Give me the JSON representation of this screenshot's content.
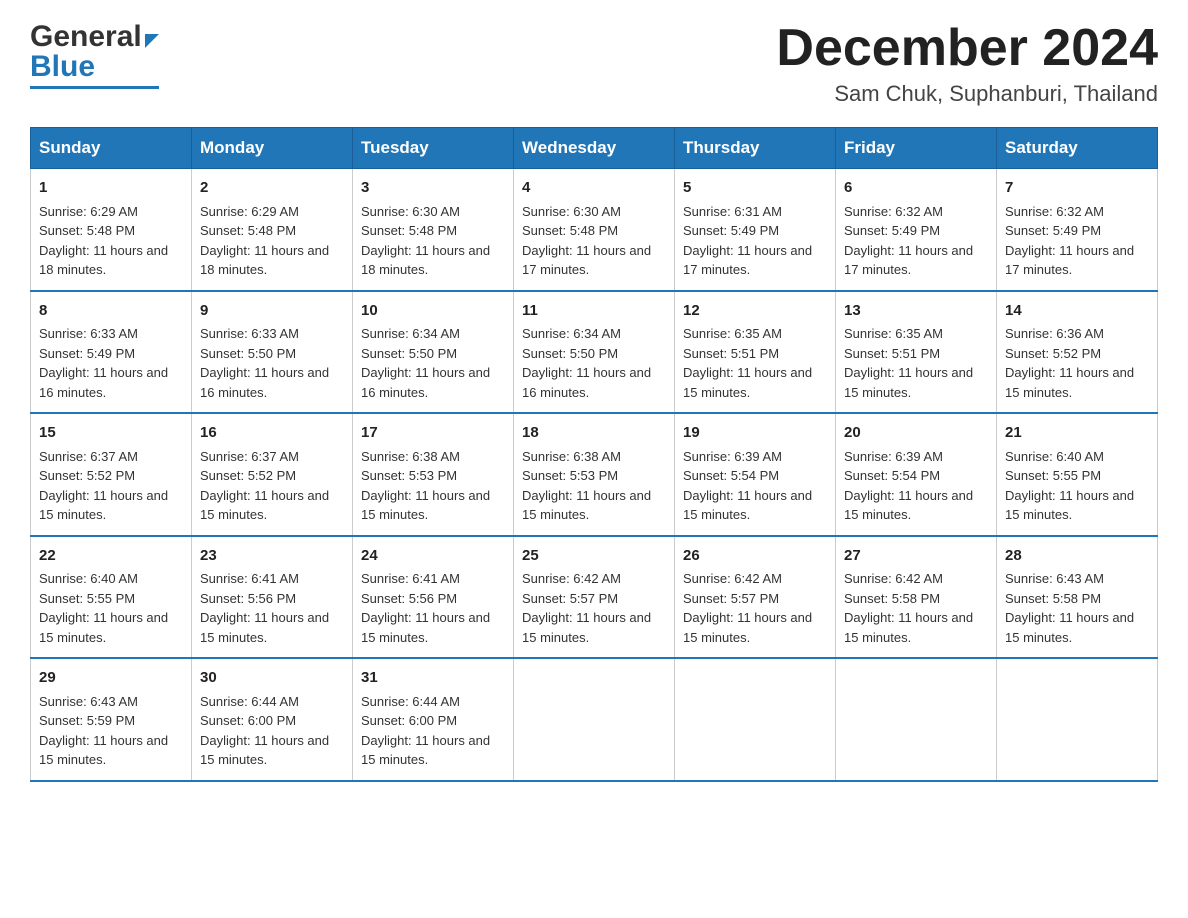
{
  "header": {
    "title": "December 2024",
    "subtitle": "Sam Chuk, Suphanburi, Thailand",
    "logo_general": "General",
    "logo_blue": "Blue"
  },
  "weekdays": [
    "Sunday",
    "Monday",
    "Tuesday",
    "Wednesday",
    "Thursday",
    "Friday",
    "Saturday"
  ],
  "weeks": [
    [
      {
        "day": "1",
        "sunrise": "6:29 AM",
        "sunset": "5:48 PM",
        "daylight": "11 hours and 18 minutes."
      },
      {
        "day": "2",
        "sunrise": "6:29 AM",
        "sunset": "5:48 PM",
        "daylight": "11 hours and 18 minutes."
      },
      {
        "day": "3",
        "sunrise": "6:30 AM",
        "sunset": "5:48 PM",
        "daylight": "11 hours and 18 minutes."
      },
      {
        "day": "4",
        "sunrise": "6:30 AM",
        "sunset": "5:48 PM",
        "daylight": "11 hours and 17 minutes."
      },
      {
        "day": "5",
        "sunrise": "6:31 AM",
        "sunset": "5:49 PM",
        "daylight": "11 hours and 17 minutes."
      },
      {
        "day": "6",
        "sunrise": "6:32 AM",
        "sunset": "5:49 PM",
        "daylight": "11 hours and 17 minutes."
      },
      {
        "day": "7",
        "sunrise": "6:32 AM",
        "sunset": "5:49 PM",
        "daylight": "11 hours and 17 minutes."
      }
    ],
    [
      {
        "day": "8",
        "sunrise": "6:33 AM",
        "sunset": "5:49 PM",
        "daylight": "11 hours and 16 minutes."
      },
      {
        "day": "9",
        "sunrise": "6:33 AM",
        "sunset": "5:50 PM",
        "daylight": "11 hours and 16 minutes."
      },
      {
        "day": "10",
        "sunrise": "6:34 AM",
        "sunset": "5:50 PM",
        "daylight": "11 hours and 16 minutes."
      },
      {
        "day": "11",
        "sunrise": "6:34 AM",
        "sunset": "5:50 PM",
        "daylight": "11 hours and 16 minutes."
      },
      {
        "day": "12",
        "sunrise": "6:35 AM",
        "sunset": "5:51 PM",
        "daylight": "11 hours and 15 minutes."
      },
      {
        "day": "13",
        "sunrise": "6:35 AM",
        "sunset": "5:51 PM",
        "daylight": "11 hours and 15 minutes."
      },
      {
        "day": "14",
        "sunrise": "6:36 AM",
        "sunset": "5:52 PM",
        "daylight": "11 hours and 15 minutes."
      }
    ],
    [
      {
        "day": "15",
        "sunrise": "6:37 AM",
        "sunset": "5:52 PM",
        "daylight": "11 hours and 15 minutes."
      },
      {
        "day": "16",
        "sunrise": "6:37 AM",
        "sunset": "5:52 PM",
        "daylight": "11 hours and 15 minutes."
      },
      {
        "day": "17",
        "sunrise": "6:38 AM",
        "sunset": "5:53 PM",
        "daylight": "11 hours and 15 minutes."
      },
      {
        "day": "18",
        "sunrise": "6:38 AM",
        "sunset": "5:53 PM",
        "daylight": "11 hours and 15 minutes."
      },
      {
        "day": "19",
        "sunrise": "6:39 AM",
        "sunset": "5:54 PM",
        "daylight": "11 hours and 15 minutes."
      },
      {
        "day": "20",
        "sunrise": "6:39 AM",
        "sunset": "5:54 PM",
        "daylight": "11 hours and 15 minutes."
      },
      {
        "day": "21",
        "sunrise": "6:40 AM",
        "sunset": "5:55 PM",
        "daylight": "11 hours and 15 minutes."
      }
    ],
    [
      {
        "day": "22",
        "sunrise": "6:40 AM",
        "sunset": "5:55 PM",
        "daylight": "11 hours and 15 minutes."
      },
      {
        "day": "23",
        "sunrise": "6:41 AM",
        "sunset": "5:56 PM",
        "daylight": "11 hours and 15 minutes."
      },
      {
        "day": "24",
        "sunrise": "6:41 AM",
        "sunset": "5:56 PM",
        "daylight": "11 hours and 15 minutes."
      },
      {
        "day": "25",
        "sunrise": "6:42 AM",
        "sunset": "5:57 PM",
        "daylight": "11 hours and 15 minutes."
      },
      {
        "day": "26",
        "sunrise": "6:42 AM",
        "sunset": "5:57 PM",
        "daylight": "11 hours and 15 minutes."
      },
      {
        "day": "27",
        "sunrise": "6:42 AM",
        "sunset": "5:58 PM",
        "daylight": "11 hours and 15 minutes."
      },
      {
        "day": "28",
        "sunrise": "6:43 AM",
        "sunset": "5:58 PM",
        "daylight": "11 hours and 15 minutes."
      }
    ],
    [
      {
        "day": "29",
        "sunrise": "6:43 AM",
        "sunset": "5:59 PM",
        "daylight": "11 hours and 15 minutes."
      },
      {
        "day": "30",
        "sunrise": "6:44 AM",
        "sunset": "6:00 PM",
        "daylight": "11 hours and 15 minutes."
      },
      {
        "day": "31",
        "sunrise": "6:44 AM",
        "sunset": "6:00 PM",
        "daylight": "11 hours and 15 minutes."
      },
      null,
      null,
      null,
      null
    ]
  ],
  "labels": {
    "sunrise": "Sunrise:",
    "sunset": "Sunset:",
    "daylight": "Daylight:"
  },
  "colors": {
    "header_bg": "#2176b8",
    "header_text": "#ffffff",
    "border": "#2176b8"
  }
}
